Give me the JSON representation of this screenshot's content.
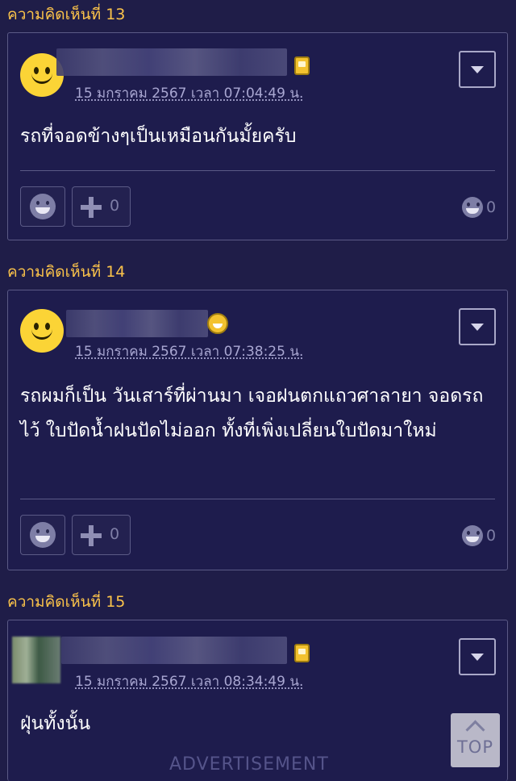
{
  "comments": [
    {
      "label": "ความคิดเห็นที่ 13",
      "timestamp": "15 มกราคม 2567 เวลา 07:04:49 น.",
      "text": "รถที่จอดข้างๆเป็นเหมือนกันมั้ยครับ",
      "plus_count": "0",
      "reaction_count": "0",
      "avatar": "smiley",
      "badge_icon": "mobile-badge-icon"
    },
    {
      "label": "ความคิดเห็นที่ 14",
      "timestamp": "15 มกราคม 2567 เวลา 07:38:25 น.",
      "text": "รถผมก็เป็น วันเสาร์ที่ผ่านมา เจอฝนตกแถวศาลายา จอดรถไว้ ใบปัดน้ำฝนปัดไม่ออก ทั้งที่เพิ่งเปลี่ยนใบปัดมาใหม่",
      "plus_count": "0",
      "reaction_count": "0",
      "avatar": "smiley",
      "badge_icon": "laughing-face-badge-icon"
    },
    {
      "label": "ความคิดเห็นที่ 15",
      "timestamp": "15 มกราคม 2567 เวลา 08:34:49 น.",
      "text": "ฝุ่นทั้งนั้น",
      "avatar": "pixelated-photo",
      "badge_icon": "mobile-badge-icon"
    }
  ],
  "top_button": {
    "label": "TOP"
  },
  "advertisement": {
    "label": "ADVERTISEMENT"
  },
  "colors": {
    "background": "#1f1d48",
    "label": "#fbc34a",
    "timestamp": "#a9a7d2"
  }
}
